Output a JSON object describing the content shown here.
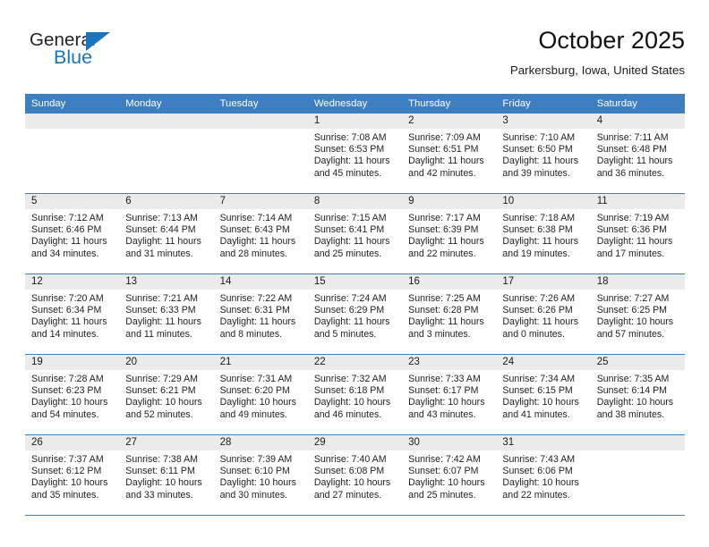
{
  "brand": {
    "word_general": "General",
    "word_blue": "Blue",
    "accent_color": "#1b75bc"
  },
  "header": {
    "title": "October 2025",
    "subtitle": "Parkersburg, Iowa, United States"
  },
  "theme": {
    "header_band_color": "#3f7fc1",
    "day_band_color": "#ebebeb",
    "text_color": "#1a1a1a"
  },
  "weekdays": [
    "Sunday",
    "Monday",
    "Tuesday",
    "Wednesday",
    "Thursday",
    "Friday",
    "Saturday"
  ],
  "weeks": [
    [
      {
        "date": "",
        "sunrise": "",
        "sunset": "",
        "daylight_line1": "",
        "daylight_line2": ""
      },
      {
        "date": "",
        "sunrise": "",
        "sunset": "",
        "daylight_line1": "",
        "daylight_line2": ""
      },
      {
        "date": "",
        "sunrise": "",
        "sunset": "",
        "daylight_line1": "",
        "daylight_line2": ""
      },
      {
        "date": "1",
        "sunrise": "Sunrise: 7:08 AM",
        "sunset": "Sunset: 6:53 PM",
        "daylight_line1": "Daylight: 11 hours",
        "daylight_line2": "and 45 minutes."
      },
      {
        "date": "2",
        "sunrise": "Sunrise: 7:09 AM",
        "sunset": "Sunset: 6:51 PM",
        "daylight_line1": "Daylight: 11 hours",
        "daylight_line2": "and 42 minutes."
      },
      {
        "date": "3",
        "sunrise": "Sunrise: 7:10 AM",
        "sunset": "Sunset: 6:50 PM",
        "daylight_line1": "Daylight: 11 hours",
        "daylight_line2": "and 39 minutes."
      },
      {
        "date": "4",
        "sunrise": "Sunrise: 7:11 AM",
        "sunset": "Sunset: 6:48 PM",
        "daylight_line1": "Daylight: 11 hours",
        "daylight_line2": "and 36 minutes."
      }
    ],
    [
      {
        "date": "5",
        "sunrise": "Sunrise: 7:12 AM",
        "sunset": "Sunset: 6:46 PM",
        "daylight_line1": "Daylight: 11 hours",
        "daylight_line2": "and 34 minutes."
      },
      {
        "date": "6",
        "sunrise": "Sunrise: 7:13 AM",
        "sunset": "Sunset: 6:44 PM",
        "daylight_line1": "Daylight: 11 hours",
        "daylight_line2": "and 31 minutes."
      },
      {
        "date": "7",
        "sunrise": "Sunrise: 7:14 AM",
        "sunset": "Sunset: 6:43 PM",
        "daylight_line1": "Daylight: 11 hours",
        "daylight_line2": "and 28 minutes."
      },
      {
        "date": "8",
        "sunrise": "Sunrise: 7:15 AM",
        "sunset": "Sunset: 6:41 PM",
        "daylight_line1": "Daylight: 11 hours",
        "daylight_line2": "and 25 minutes."
      },
      {
        "date": "9",
        "sunrise": "Sunrise: 7:17 AM",
        "sunset": "Sunset: 6:39 PM",
        "daylight_line1": "Daylight: 11 hours",
        "daylight_line2": "and 22 minutes."
      },
      {
        "date": "10",
        "sunrise": "Sunrise: 7:18 AM",
        "sunset": "Sunset: 6:38 PM",
        "daylight_line1": "Daylight: 11 hours",
        "daylight_line2": "and 19 minutes."
      },
      {
        "date": "11",
        "sunrise": "Sunrise: 7:19 AM",
        "sunset": "Sunset: 6:36 PM",
        "daylight_line1": "Daylight: 11 hours",
        "daylight_line2": "and 17 minutes."
      }
    ],
    [
      {
        "date": "12",
        "sunrise": "Sunrise: 7:20 AM",
        "sunset": "Sunset: 6:34 PM",
        "daylight_line1": "Daylight: 11 hours",
        "daylight_line2": "and 14 minutes."
      },
      {
        "date": "13",
        "sunrise": "Sunrise: 7:21 AM",
        "sunset": "Sunset: 6:33 PM",
        "daylight_line1": "Daylight: 11 hours",
        "daylight_line2": "and 11 minutes."
      },
      {
        "date": "14",
        "sunrise": "Sunrise: 7:22 AM",
        "sunset": "Sunset: 6:31 PM",
        "daylight_line1": "Daylight: 11 hours",
        "daylight_line2": "and 8 minutes."
      },
      {
        "date": "15",
        "sunrise": "Sunrise: 7:24 AM",
        "sunset": "Sunset: 6:29 PM",
        "daylight_line1": "Daylight: 11 hours",
        "daylight_line2": "and 5 minutes."
      },
      {
        "date": "16",
        "sunrise": "Sunrise: 7:25 AM",
        "sunset": "Sunset: 6:28 PM",
        "daylight_line1": "Daylight: 11 hours",
        "daylight_line2": "and 3 minutes."
      },
      {
        "date": "17",
        "sunrise": "Sunrise: 7:26 AM",
        "sunset": "Sunset: 6:26 PM",
        "daylight_line1": "Daylight: 11 hours",
        "daylight_line2": "and 0 minutes."
      },
      {
        "date": "18",
        "sunrise": "Sunrise: 7:27 AM",
        "sunset": "Sunset: 6:25 PM",
        "daylight_line1": "Daylight: 10 hours",
        "daylight_line2": "and 57 minutes."
      }
    ],
    [
      {
        "date": "19",
        "sunrise": "Sunrise: 7:28 AM",
        "sunset": "Sunset: 6:23 PM",
        "daylight_line1": "Daylight: 10 hours",
        "daylight_line2": "and 54 minutes."
      },
      {
        "date": "20",
        "sunrise": "Sunrise: 7:29 AM",
        "sunset": "Sunset: 6:21 PM",
        "daylight_line1": "Daylight: 10 hours",
        "daylight_line2": "and 52 minutes."
      },
      {
        "date": "21",
        "sunrise": "Sunrise: 7:31 AM",
        "sunset": "Sunset: 6:20 PM",
        "daylight_line1": "Daylight: 10 hours",
        "daylight_line2": "and 49 minutes."
      },
      {
        "date": "22",
        "sunrise": "Sunrise: 7:32 AM",
        "sunset": "Sunset: 6:18 PM",
        "daylight_line1": "Daylight: 10 hours",
        "daylight_line2": "and 46 minutes."
      },
      {
        "date": "23",
        "sunrise": "Sunrise: 7:33 AM",
        "sunset": "Sunset: 6:17 PM",
        "daylight_line1": "Daylight: 10 hours",
        "daylight_line2": "and 43 minutes."
      },
      {
        "date": "24",
        "sunrise": "Sunrise: 7:34 AM",
        "sunset": "Sunset: 6:15 PM",
        "daylight_line1": "Daylight: 10 hours",
        "daylight_line2": "and 41 minutes."
      },
      {
        "date": "25",
        "sunrise": "Sunrise: 7:35 AM",
        "sunset": "Sunset: 6:14 PM",
        "daylight_line1": "Daylight: 10 hours",
        "daylight_line2": "and 38 minutes."
      }
    ],
    [
      {
        "date": "26",
        "sunrise": "Sunrise: 7:37 AM",
        "sunset": "Sunset: 6:12 PM",
        "daylight_line1": "Daylight: 10 hours",
        "daylight_line2": "and 35 minutes."
      },
      {
        "date": "27",
        "sunrise": "Sunrise: 7:38 AM",
        "sunset": "Sunset: 6:11 PM",
        "daylight_line1": "Daylight: 10 hours",
        "daylight_line2": "and 33 minutes."
      },
      {
        "date": "28",
        "sunrise": "Sunrise: 7:39 AM",
        "sunset": "Sunset: 6:10 PM",
        "daylight_line1": "Daylight: 10 hours",
        "daylight_line2": "and 30 minutes."
      },
      {
        "date": "29",
        "sunrise": "Sunrise: 7:40 AM",
        "sunset": "Sunset: 6:08 PM",
        "daylight_line1": "Daylight: 10 hours",
        "daylight_line2": "and 27 minutes."
      },
      {
        "date": "30",
        "sunrise": "Sunrise: 7:42 AM",
        "sunset": "Sunset: 6:07 PM",
        "daylight_line1": "Daylight: 10 hours",
        "daylight_line2": "and 25 minutes."
      },
      {
        "date": "31",
        "sunrise": "Sunrise: 7:43 AM",
        "sunset": "Sunset: 6:06 PM",
        "daylight_line1": "Daylight: 10 hours",
        "daylight_line2": "and 22 minutes."
      },
      {
        "date": "",
        "sunrise": "",
        "sunset": "",
        "daylight_line1": "",
        "daylight_line2": ""
      }
    ]
  ]
}
